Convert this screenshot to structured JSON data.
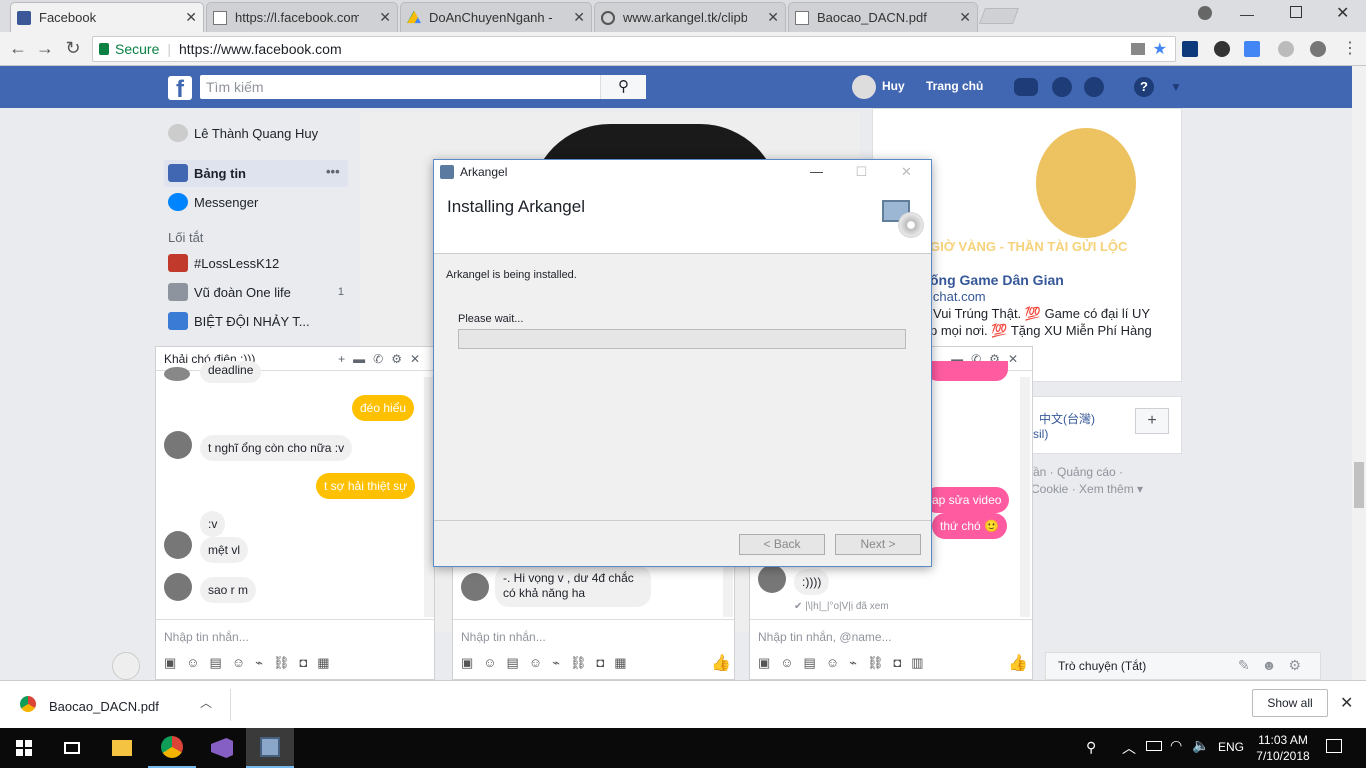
{
  "browser": {
    "tabs": [
      {
        "label": "Facebook",
        "active": true,
        "icon": "facebook-icon"
      },
      {
        "label": "https://l.facebook.com/l.p",
        "icon": "page-icon"
      },
      {
        "label": "DoAnChuyenNganh - Go",
        "icon": "drive-icon"
      },
      {
        "label": "www.arkangel.tk/clipboa",
        "icon": "web-icon"
      },
      {
        "label": "Baocao_DACN.pdf",
        "icon": "page-icon"
      }
    ],
    "secure_label": "Secure",
    "url": "https://www.facebook.com"
  },
  "fb": {
    "search_placeholder": "Tìm kiếm",
    "user": "Huy",
    "home": "Trang chủ",
    "left_nav": {
      "profile": "Lê Thành Quang Huy",
      "news_feed": "Bảng tin",
      "messenger": "Messenger",
      "shortcuts_title": "Lối tắt",
      "shortcuts": [
        {
          "label": "#LossLessK12",
          "count": ""
        },
        {
          "label": "Vũ đoàn One life",
          "count": "1"
        },
        {
          "label": "BIỆT ĐỘI NHẢY T...",
          "count": ""
        }
      ]
    },
    "ad": {
      "banner_text": "OT SỐ GIỜ VÀNG - THẦN TÀI GỬI LỘC",
      "title": "ống Game Dân Gian",
      "domain": "ichat.com",
      "line1": "Vui Trúng Thật. 💯 Game có đại lí UY",
      "line2": "p mọi nơi. 💯 Tặng XU Miễn Phí Hàng"
    },
    "lang": {
      "line1": "中文(台灣)",
      "line2": "sil)"
    },
    "footer_links": {
      "line1": "ần · Quảng cáo ·",
      "line2": "Cookie · Xem thêm ▾"
    }
  },
  "chats": {
    "chat1": {
      "title": "Khải chó điên :)))",
      "messages": [
        {
          "text": "deadline",
          "from": "them"
        },
        {
          "text": "đéo hiểu",
          "from": "me"
        },
        {
          "text": "t nghĩ ổng còn cho nữa :v",
          "from": "them"
        },
        {
          "text": "t sợ hải thiệt sự",
          "from": "me"
        },
        {
          "text": ":v",
          "from": "them"
        },
        {
          "text": "mệt vl",
          "from": "them"
        },
        {
          "text": "sao r m",
          "from": "them"
        }
      ],
      "input_placeholder": "Nhập tin nhắn..."
    },
    "chat2": {
      "message": "-. Hi vọng v , dư 4đ chắc có khả năng ha",
      "input_placeholder": "Nhập tin nhắn..."
    },
    "chat3": {
      "msgs_me": [
        "ap sửa video",
        "thứ chó 🙂"
      ],
      "msg_them": ":))))",
      "seen": "✔ |\\|h|_|°o|V|ị đã xem",
      "input_placeholder": "Nhập tin nhắn, @name..."
    },
    "chat_sidebar": "Trò chuyện (Tắt)"
  },
  "installer": {
    "window_title": "Arkangel",
    "heading": "Installing Arkangel",
    "status": "Arkangel is being installed.",
    "please_wait": "Please wait...",
    "progress": 0,
    "back_label": "< Back",
    "next_label": "Next >"
  },
  "downloads": {
    "file": "Baocao_DACN.pdf",
    "show_all": "Show all"
  },
  "taskbar": {
    "time": "11:03 AM",
    "date": "7/10/2018",
    "lang": "ENG"
  }
}
